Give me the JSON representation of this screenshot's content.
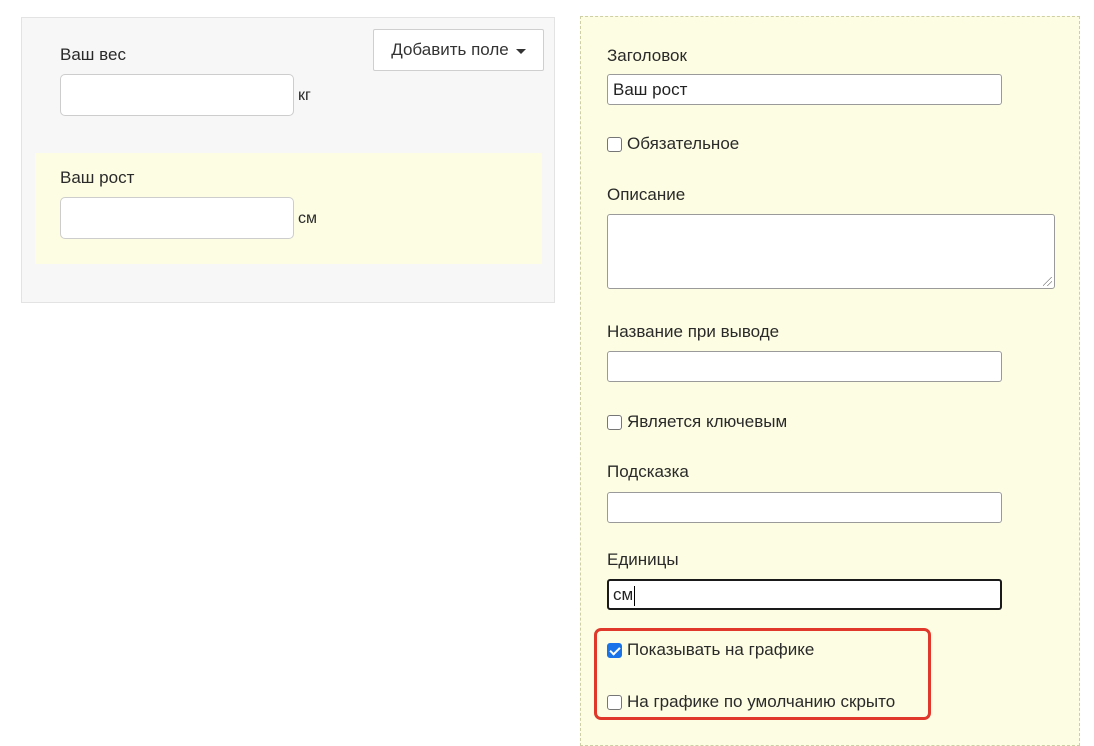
{
  "preview": {
    "add_field_label": "Добавить поле",
    "fields": [
      {
        "label": "Ваш вес",
        "value": "",
        "unit": "кг"
      },
      {
        "label": "Ваш рост",
        "value": "",
        "unit": "см"
      }
    ]
  },
  "editor": {
    "title_label": "Заголовок",
    "title_value": "Ваш рост",
    "required_label": "Обязательное",
    "required_checked": false,
    "description_label": "Описание",
    "description_value": "",
    "output_name_label": "Название при выводе",
    "output_name_value": "",
    "is_key_label": "Является ключевым",
    "is_key_checked": false,
    "hint_label": "Подсказка",
    "hint_value": "",
    "units_label": "Единицы",
    "units_value": "см",
    "show_on_chart_label": "Показывать на графике",
    "show_on_chart_checked": true,
    "hidden_by_default_label": "На графике по умолчанию скрыто",
    "hidden_by_default_checked": false
  },
  "colors": {
    "highlight": "#e0392b",
    "selected_field_bg": "#fdfde3",
    "checkbox_accent": "#1a73e8"
  }
}
